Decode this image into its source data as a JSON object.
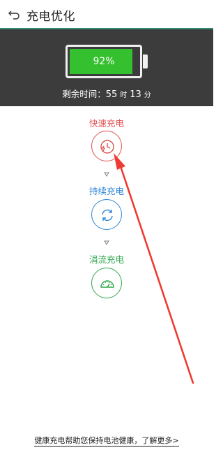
{
  "header": {
    "title": "充电优化",
    "back_icon": "back-arrow-icon"
  },
  "battery": {
    "percent_label": "92%",
    "level": 0.92,
    "remaining_prefix": "剩余时间：",
    "hours": "55",
    "hours_unit": "时",
    "minutes": "13",
    "minutes_unit": "分"
  },
  "stages": [
    {
      "label": "快速充电",
      "icon": "fast-charge-clock-icon",
      "color": "#e0524f",
      "active": true
    },
    {
      "label": "持续充电",
      "icon": "refresh-cycle-icon",
      "color": "#2f86d6"
    },
    {
      "label": "涓流充电",
      "icon": "speedometer-icon",
      "color": "#2fa84a"
    }
  ],
  "footer": {
    "link_text": "健康充电帮助您保持电池健康，了解更多>"
  },
  "colors": {
    "panel_bg": "#3c3c3c",
    "battery_green": "#34c02f",
    "annotation_arrow": "#ee3b33"
  }
}
